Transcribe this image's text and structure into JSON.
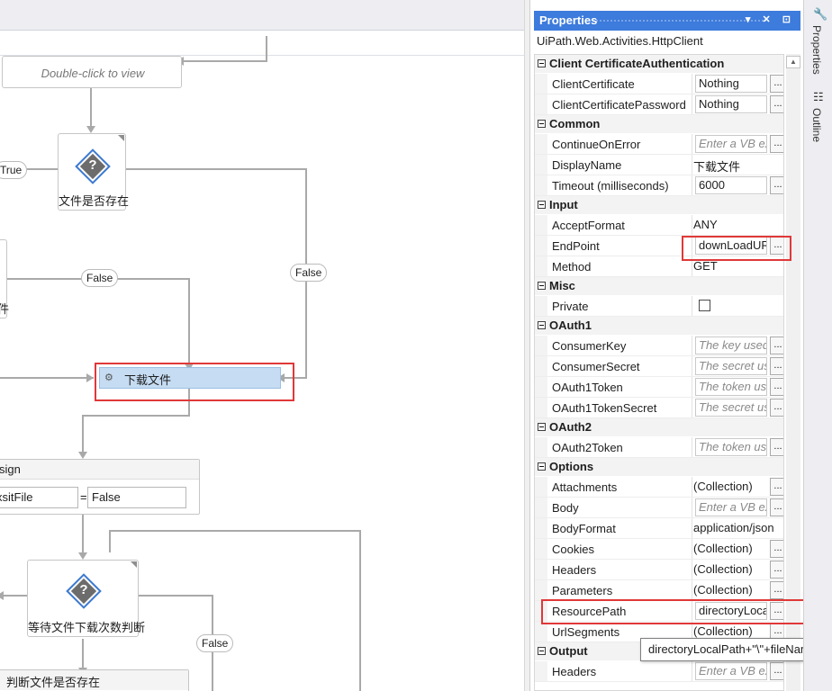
{
  "designer": {
    "double_click_text": "Double-click to view",
    "decision1_label": "文件是否存在",
    "true_label": "True",
    "false_label_1": "False",
    "false_label_2": "False",
    "left_partial_text": "件",
    "download_activity": "下载文件",
    "assign_header": "sign",
    "assign_left": "xsitFile",
    "assign_eq": "=",
    "assign_right": "False",
    "decision2_label": "等待文件下载次数判断",
    "false_label_3": "False",
    "decision3_header": "判断文件是否存在"
  },
  "properties": {
    "title": "Properties",
    "header_icons": "▾ ✕ ⊡",
    "activity_type": "UiPath.Web.Activities.HttpClient",
    "categories": [
      {
        "name": "Client CertificateAuthentication",
        "rows": [
          {
            "name": "ClientCertificate",
            "value": "Nothing",
            "kind": "box"
          },
          {
            "name": "ClientCertificatePassword",
            "value": "Nothing",
            "kind": "box"
          }
        ]
      },
      {
        "name": "Common",
        "rows": [
          {
            "name": "ContinueOnError",
            "value": "Enter a VB ex",
            "kind": "ph"
          },
          {
            "name": "DisplayName",
            "value": "下载文件",
            "kind": "text"
          },
          {
            "name": "Timeout (milliseconds)",
            "value": "6000",
            "kind": "box"
          }
        ]
      },
      {
        "name": "Input",
        "rows": [
          {
            "name": "AcceptFormat",
            "value": "ANY",
            "kind": "text"
          },
          {
            "name": "EndPoint",
            "value": "downLoadUR",
            "kind": "box"
          },
          {
            "name": "Method",
            "value": "GET",
            "kind": "text"
          }
        ]
      },
      {
        "name": "Misc",
        "rows": [
          {
            "name": "Private",
            "value": "",
            "kind": "check"
          }
        ]
      },
      {
        "name": "OAuth1",
        "rows": [
          {
            "name": "ConsumerKey",
            "value": "The key used",
            "kind": "ph"
          },
          {
            "name": "ConsumerSecret",
            "value": "The secret us",
            "kind": "ph"
          },
          {
            "name": "OAuth1Token",
            "value": "The token us",
            "kind": "ph"
          },
          {
            "name": "OAuth1TokenSecret",
            "value": "The secret us",
            "kind": "ph"
          }
        ]
      },
      {
        "name": "OAuth2",
        "rows": [
          {
            "name": "OAuth2Token",
            "value": "The token us",
            "kind": "ph"
          }
        ]
      },
      {
        "name": "Options",
        "rows": [
          {
            "name": "Attachments",
            "value": "(Collection)",
            "kind": "text"
          },
          {
            "name": "Body",
            "value": "Enter a VB ex",
            "kind": "ph"
          },
          {
            "name": "BodyFormat",
            "value": "application/json",
            "kind": "text"
          },
          {
            "name": "Cookies",
            "value": "(Collection)",
            "kind": "text"
          },
          {
            "name": "Headers",
            "value": "(Collection)",
            "kind": "text"
          },
          {
            "name": "Parameters",
            "value": "(Collection)",
            "kind": "text"
          },
          {
            "name": "ResourcePath",
            "value": "directoryLoca",
            "kind": "box"
          },
          {
            "name": "UrlSegments",
            "value": "(Collection)",
            "kind": "text"
          }
        ]
      },
      {
        "name": "Output",
        "rows": [
          {
            "name": "Headers",
            "value": "Enter a VB ex",
            "kind": "ph"
          }
        ]
      }
    ],
    "tooltip": "directoryLocalPath+\"\\\"+fileName"
  },
  "side_tabs": {
    "properties": "Properties",
    "outline": "Outline"
  },
  "colors": {
    "accent": "#3d7bdc",
    "highlight": "#e03838",
    "selected_activity": "#c5dcf2"
  }
}
